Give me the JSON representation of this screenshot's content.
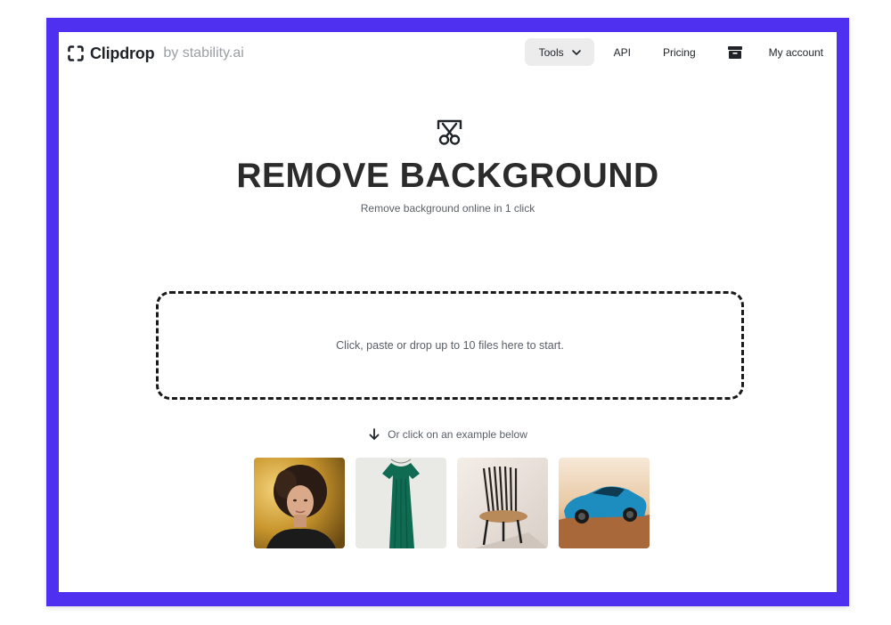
{
  "header": {
    "brand_name": "Clipdrop",
    "brand_suffix": "by stability.ai",
    "nav": {
      "tools_label": "Tools",
      "api_label": "API",
      "pricing_label": "Pricing",
      "account_label": "My account"
    },
    "icons": [
      "clipdrop-logo-icon",
      "chevron-down-icon",
      "archive-icon"
    ]
  },
  "hero": {
    "icon": "scissors-cut-icon",
    "title": "REMOVE BACKGROUND",
    "subtitle": "Remove background online in 1 click"
  },
  "dropzone": {
    "text": "Click, paste or drop up to 10 files here to start."
  },
  "examples": {
    "hint": "Or click on an example below",
    "hint_icon": "arrow-down-icon",
    "items": [
      "portrait-photo",
      "green-dress-photo",
      "wooden-chair-photo",
      "blue-car-photo"
    ]
  },
  "colors": {
    "frame": "#4f2ff0",
    "background": "#ffffff",
    "tools_button_bg": "#ececec",
    "title": "#2b2b2b",
    "muted_text": "#5a5f66"
  }
}
